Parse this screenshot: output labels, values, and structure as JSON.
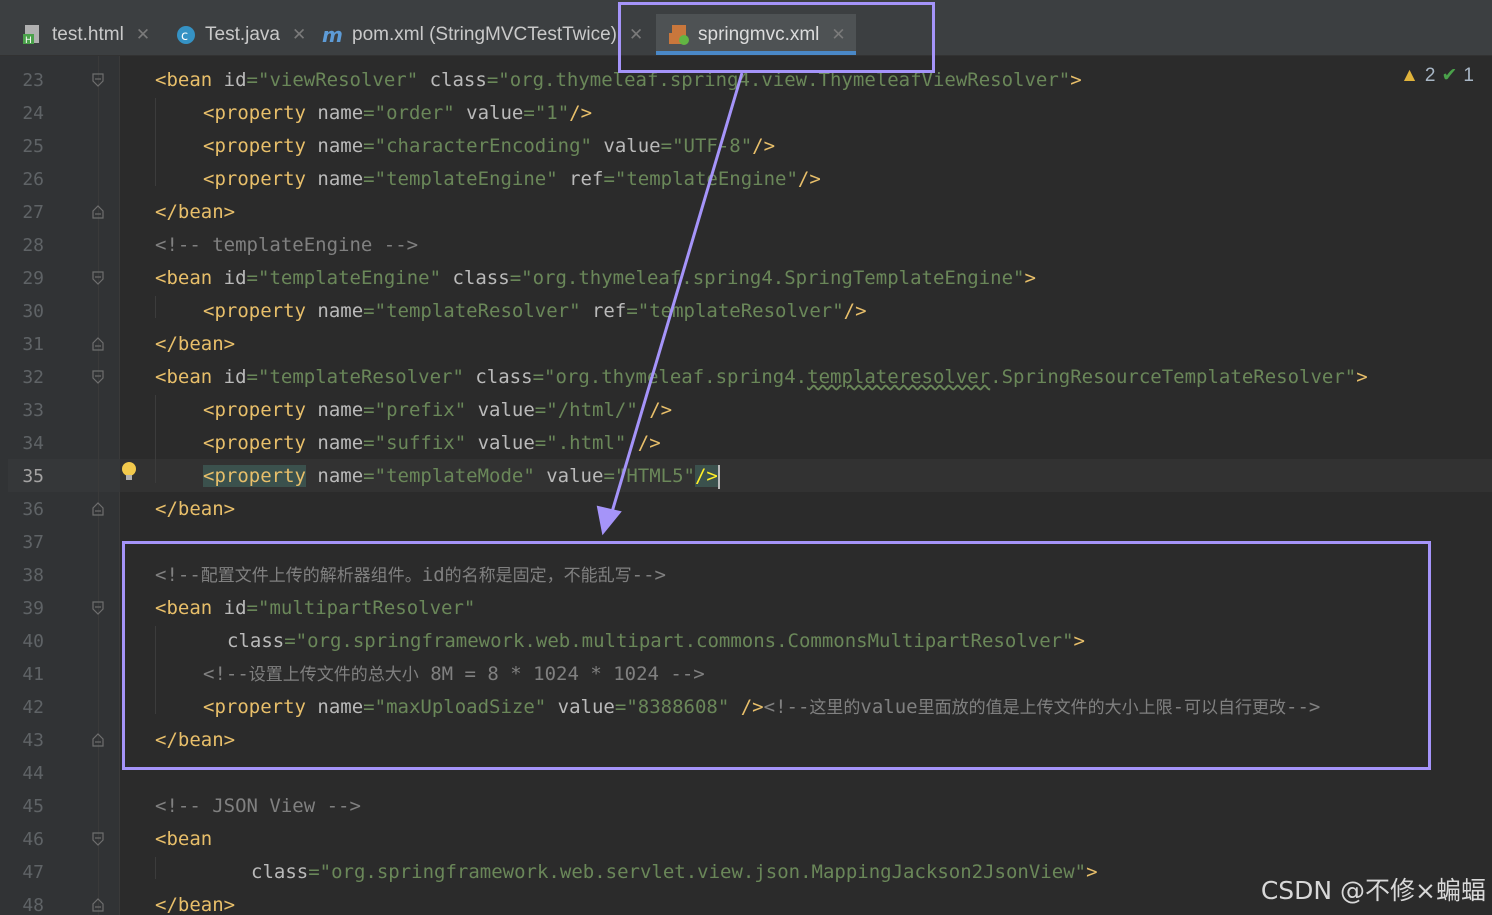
{
  "tabs": [
    {
      "label": "test.html",
      "icon": "html-file-icon"
    },
    {
      "label": "Test.java",
      "icon": "java-class-icon"
    },
    {
      "label": "pom.xml (StringMVCTestTwice)",
      "icon": "maven-icon"
    },
    {
      "label": "springmvc.xml",
      "icon": "spring-xml-icon",
      "active": true
    }
  ],
  "inspections": {
    "warnings": "2",
    "checks": "1"
  },
  "lines": [
    {
      "n": "23"
    },
    {
      "n": "24"
    },
    {
      "n": "25"
    },
    {
      "n": "26"
    },
    {
      "n": "27"
    },
    {
      "n": "28"
    },
    {
      "n": "29"
    },
    {
      "n": "30"
    },
    {
      "n": "31"
    },
    {
      "n": "32"
    },
    {
      "n": "33"
    },
    {
      "n": "34"
    },
    {
      "n": "35"
    },
    {
      "n": "36"
    },
    {
      "n": "37"
    },
    {
      "n": "38"
    },
    {
      "n": "39"
    },
    {
      "n": "40"
    },
    {
      "n": "41"
    },
    {
      "n": "42"
    },
    {
      "n": "43"
    },
    {
      "n": "44"
    },
    {
      "n": "45"
    },
    {
      "n": "46"
    },
    {
      "n": "47"
    },
    {
      "n": "48"
    }
  ],
  "code": {
    "l23": {
      "id": "\"viewResolver\"",
      "cls": "\"org.thymeleaf.spring4.view.ThymeleafViewResolver\""
    },
    "l24": {
      "name": "\"order\"",
      "value": "\"1\""
    },
    "l25": {
      "name": "\"characterEncoding\"",
      "value": "\"UTF-8\""
    },
    "l26": {
      "name": "\"templateEngine\"",
      "ref": "\"templateEngine\""
    },
    "l28": "<!-- templateEngine -->",
    "l29": {
      "id": "\"templateEngine\"",
      "cls": "\"org.thymeleaf.spring4.SpringTemplateEngine\""
    },
    "l30": {
      "name": "\"templateResolver\"",
      "ref": "\"templateResolver\""
    },
    "l32": {
      "id": "\"templateResolver\"",
      "cls_a": "\"org.thymeleaf.spring4.",
      "cls_b": "templateresolver",
      "cls_c": ".SpringResourceTemplateResolver\""
    },
    "l33": {
      "name": "\"prefix\"",
      "value": "\"/html/\""
    },
    "l34": {
      "name": "\"suffix\"",
      "value": "\".html\""
    },
    "l35": {
      "name": "\"templateMode\"",
      "value": "\"HTML5\""
    },
    "l38_a": "<!--",
    "l38_b": "配置文件上传的解析器组件。",
    "l38_c": "id",
    "l38_d": "的名称是固定，不能乱写",
    "l38_e": "-->",
    "l39": {
      "id": "\"multipartResolver\""
    },
    "l40": {
      "cls": "\"org.springframework.web.multipart.commons.CommonsMultipartResolver\""
    },
    "l41_a": "<!--",
    "l41_b": "设置上传文件的总大小",
    "l41_c": " 8M = 8 * 1024 * 1024 -->",
    "l42": {
      "name": "\"maxUploadSize\"",
      "value": "\"8388608\""
    },
    "l42_c1": "<!--",
    "l42_c2": "这里的",
    "l42_c3": "value",
    "l42_c4": "里面放的值是上传文件的大小上限",
    "l42_c5": "-",
    "l42_c6": "可以自行更改",
    "l42_c7": "-->",
    "l45": "<!-- JSON View -->",
    "l47": {
      "cls": "\"org.springframework.web.servlet.view.json.MappingJackson2JsonView\""
    }
  },
  "tokens": {
    "bean_open": "<bean",
    "bean_close": "</bean>",
    "property": "<property",
    "id_attr": "id",
    "class_attr": "class",
    "name_attr": "name",
    "value_attr": "value",
    "ref_attr": "ref",
    "eq": "=",
    "gt": ">",
    "selfclose": "/>"
  },
  "watermark": "CSDN @不修×蝙蝠",
  "colors": {
    "annotation": "#a594f9",
    "tag": "#e8bf6a",
    "string": "#6a8759",
    "comment": "#808080"
  }
}
